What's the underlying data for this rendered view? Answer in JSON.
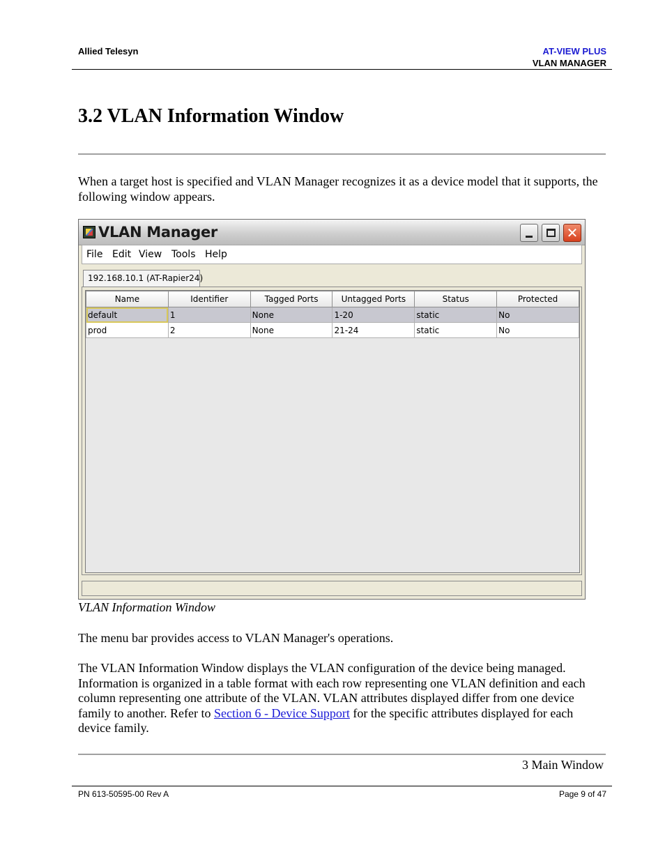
{
  "header": {
    "company": "Allied Telesyn",
    "product": "AT-VIEW PLUS",
    "module": "VLAN MANAGER"
  },
  "section_title": "3.2 VLAN Information Window",
  "intro": "When a target host is specified and VLAN Manager recognizes it as a device model that it supports, the following window appears.",
  "window": {
    "title": "VLAN Manager",
    "menus": [
      "File",
      "Edit",
      "View",
      "Tools",
      "Help"
    ],
    "tab_label": "192.168.10.1 (AT-Rapier24)",
    "columns": [
      "Name",
      "Identifier",
      "Tagged Ports",
      "Untagged Ports",
      "Status",
      "Protected"
    ],
    "rows": [
      [
        "default",
        "1",
        "None",
        "1-20",
        "static",
        "No"
      ],
      [
        "prod",
        "2",
        "None",
        "21-24",
        "static",
        "No"
      ]
    ],
    "icons": [
      "app-icon",
      "minimize-icon",
      "maximize-icon",
      "close-icon"
    ]
  },
  "caption": "VLAN Information Window",
  "menubar_text": "The menu bar provides access to VLAN Manager's operations.",
  "body": {
    "before_link": "The VLAN Information Window displays the VLAN configuration of the device being managed. Information is organized in a table format with each row representing one VLAN definition and each column representing one attribute of the VLAN. VLAN attributes displayed differ from one device family to another. Refer to ",
    "link": "Section 6 - Device Support",
    "after_link": " for the specific attributes displayed for each device family."
  },
  "footer": {
    "chapter": "3 Main Window",
    "part_number": "PN 613-50595-00 Rev A",
    "page": "Page 9 of 47"
  },
  "colors": {
    "product_blue": "#1c1cd2",
    "link_blue": "#1a1ad6",
    "selected_row": "#c8c8d0",
    "close_button": "#d8401e"
  }
}
